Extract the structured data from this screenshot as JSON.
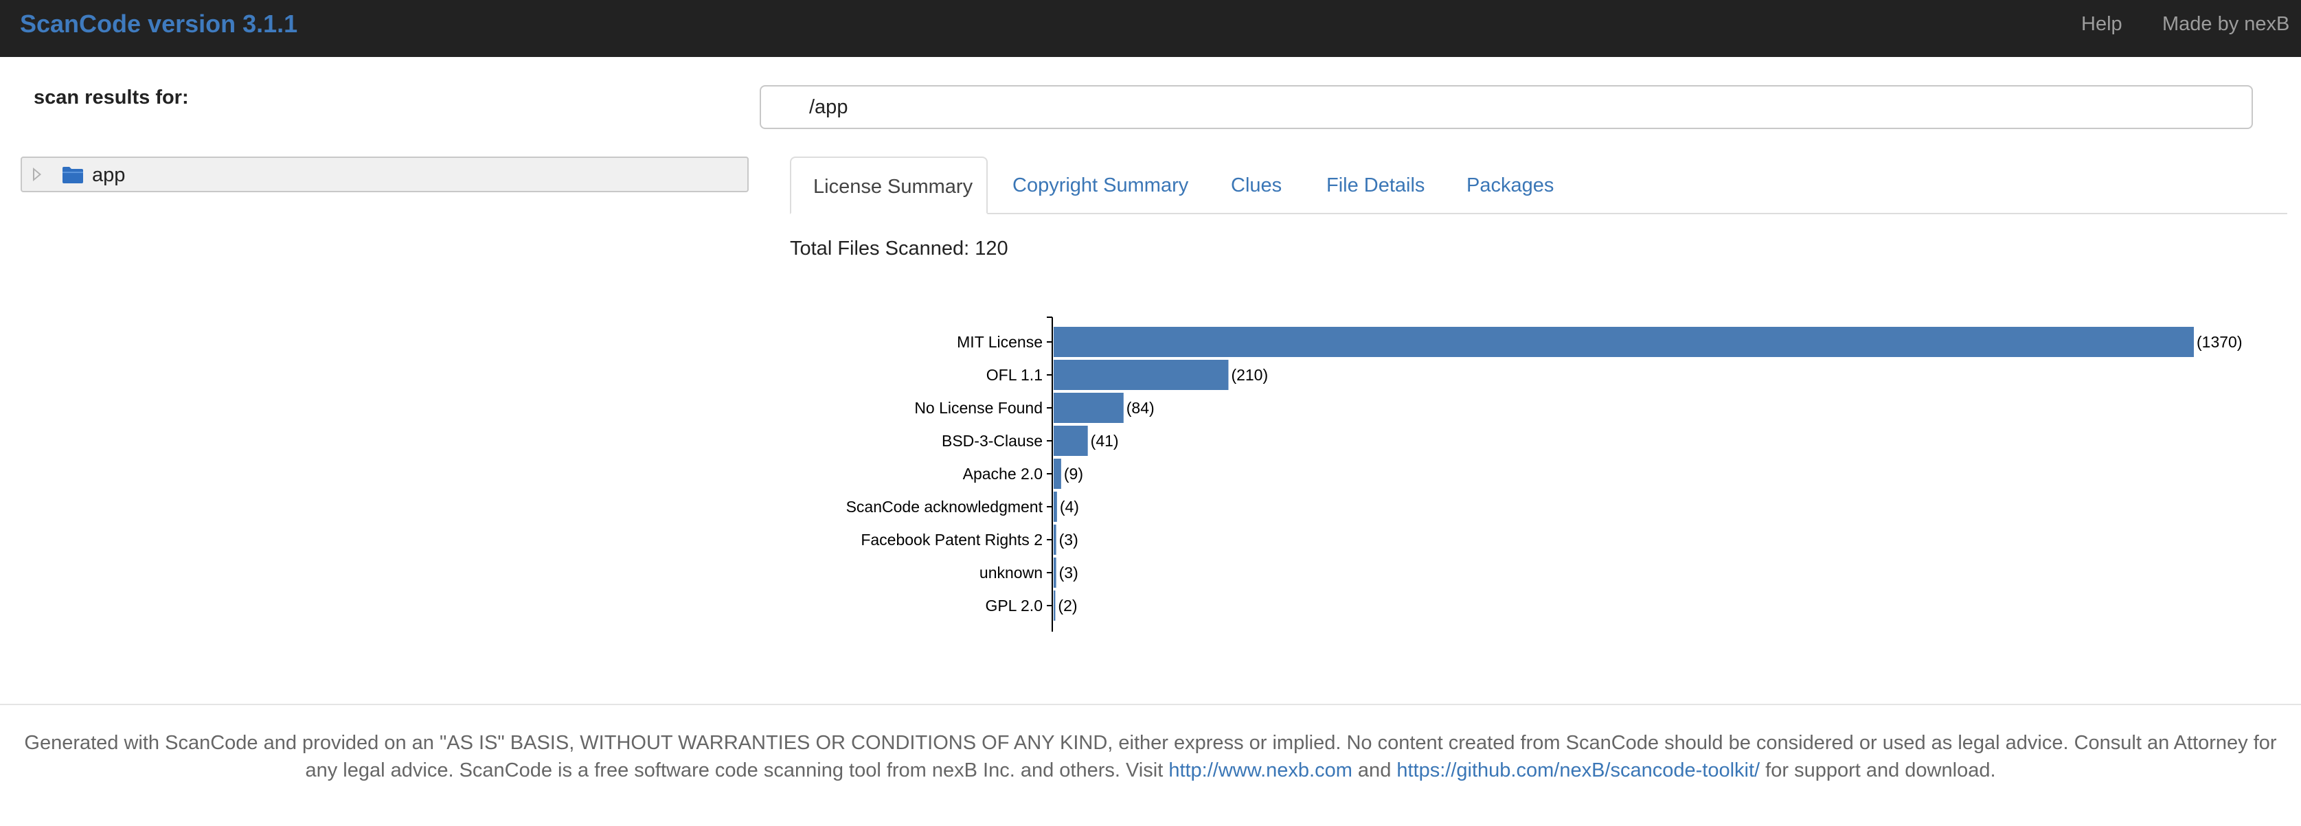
{
  "navbar": {
    "brand": "ScanCode version 3.1.1",
    "help": "Help",
    "made_by": "Made by nexB"
  },
  "scan": {
    "label": "scan results for:",
    "path_value": "/app"
  },
  "tree": {
    "root_label": "app"
  },
  "tabs": [
    {
      "label": "License Summary",
      "active": true
    },
    {
      "label": "Copyright Summary",
      "active": false
    },
    {
      "label": "Clues",
      "active": false
    },
    {
      "label": "File Details",
      "active": false
    },
    {
      "label": "Packages",
      "active": false
    }
  ],
  "summary": {
    "total_files": "Total Files Scanned: 120"
  },
  "chart_data": {
    "type": "bar",
    "orientation": "horizontal",
    "categories": [
      "MIT License",
      "OFL 1.1",
      "No License Found",
      "BSD-3-Clause",
      "Apache 2.0",
      "ScanCode acknowledgment",
      "Facebook Patent Rights 2",
      "unknown",
      "GPL 2.0"
    ],
    "values": [
      1370,
      210,
      84,
      41,
      9,
      4,
      3,
      3,
      2
    ],
    "value_labels": [
      "(1370)",
      "(210)",
      "(84)",
      "(41)",
      "(9)",
      "(4)",
      "(3)",
      "(3)",
      "(2)"
    ],
    "bar_color": "#4a7bb3"
  },
  "footer": {
    "text_1": "Generated with ScanCode and provided on an \"AS IS\" BASIS, WITHOUT WARRANTIES OR CONDITIONS OF ANY KIND, either express or implied. No content created from ScanCode should be considered or used as legal advice. Consult an Attorney for any legal advice. ScanCode is a free software code scanning tool from nexB Inc. and others. Visit ",
    "link_1": "http://www.nexb.com",
    "text_2": " and ",
    "link_2": "https://github.com/nexB/scancode-toolkit/",
    "text_3": " for support and download."
  },
  "colors": {
    "navbar_bg": "#222222",
    "brand": "#3f7bbf",
    "link": "#3a76b6"
  }
}
